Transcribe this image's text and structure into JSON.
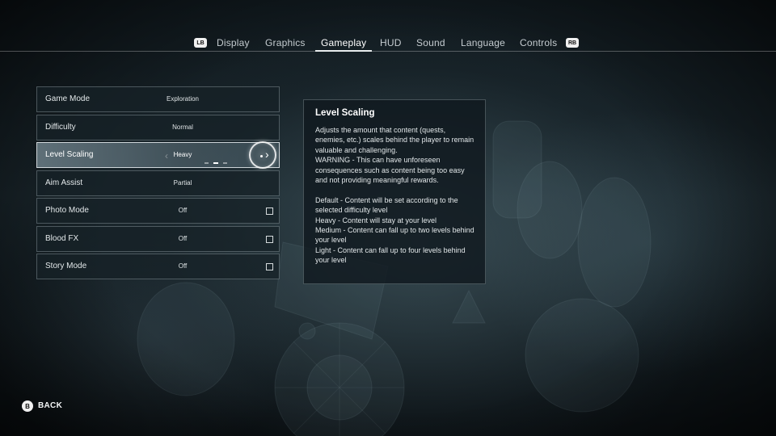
{
  "topnav": {
    "left_bumper": "LB",
    "right_bumper": "RB",
    "tabs": [
      {
        "label": "Display"
      },
      {
        "label": "Graphics"
      },
      {
        "label": "Gameplay"
      },
      {
        "label": "HUD"
      },
      {
        "label": "Sound"
      },
      {
        "label": "Language"
      },
      {
        "label": "Controls"
      }
    ],
    "active_tab": "Gameplay"
  },
  "settings": [
    {
      "label": "Game Mode",
      "value": "Exploration"
    },
    {
      "label": "Difficulty",
      "value": "Normal"
    },
    {
      "label": "Level Scaling",
      "value": "Heavy",
      "selected": true
    },
    {
      "label": "Aim Assist",
      "value": "Partial"
    },
    {
      "label": "Photo Mode",
      "value": "Off",
      "checked": false
    },
    {
      "label": "Blood FX",
      "value": "Off",
      "checked": false
    },
    {
      "label": "Story Mode",
      "value": "Off",
      "checked": false
    }
  ],
  "description": {
    "title": "Level Scaling",
    "body": "Adjusts the amount that content (quests, enemies, etc.) scales behind the player to remain valuable and challenging.\nWARNING - This can have unforeseen consequences such as content being too easy and not providing meaningful rewards.\n\nDefault - Content will be set according to the selected difficulty level\nHeavy - Content will stay at your level\nMedium - Content can fall up to two levels behind your level\nLight - Content can fall up to four levels behind your level"
  },
  "back": {
    "button": "B",
    "label": "BACK"
  }
}
